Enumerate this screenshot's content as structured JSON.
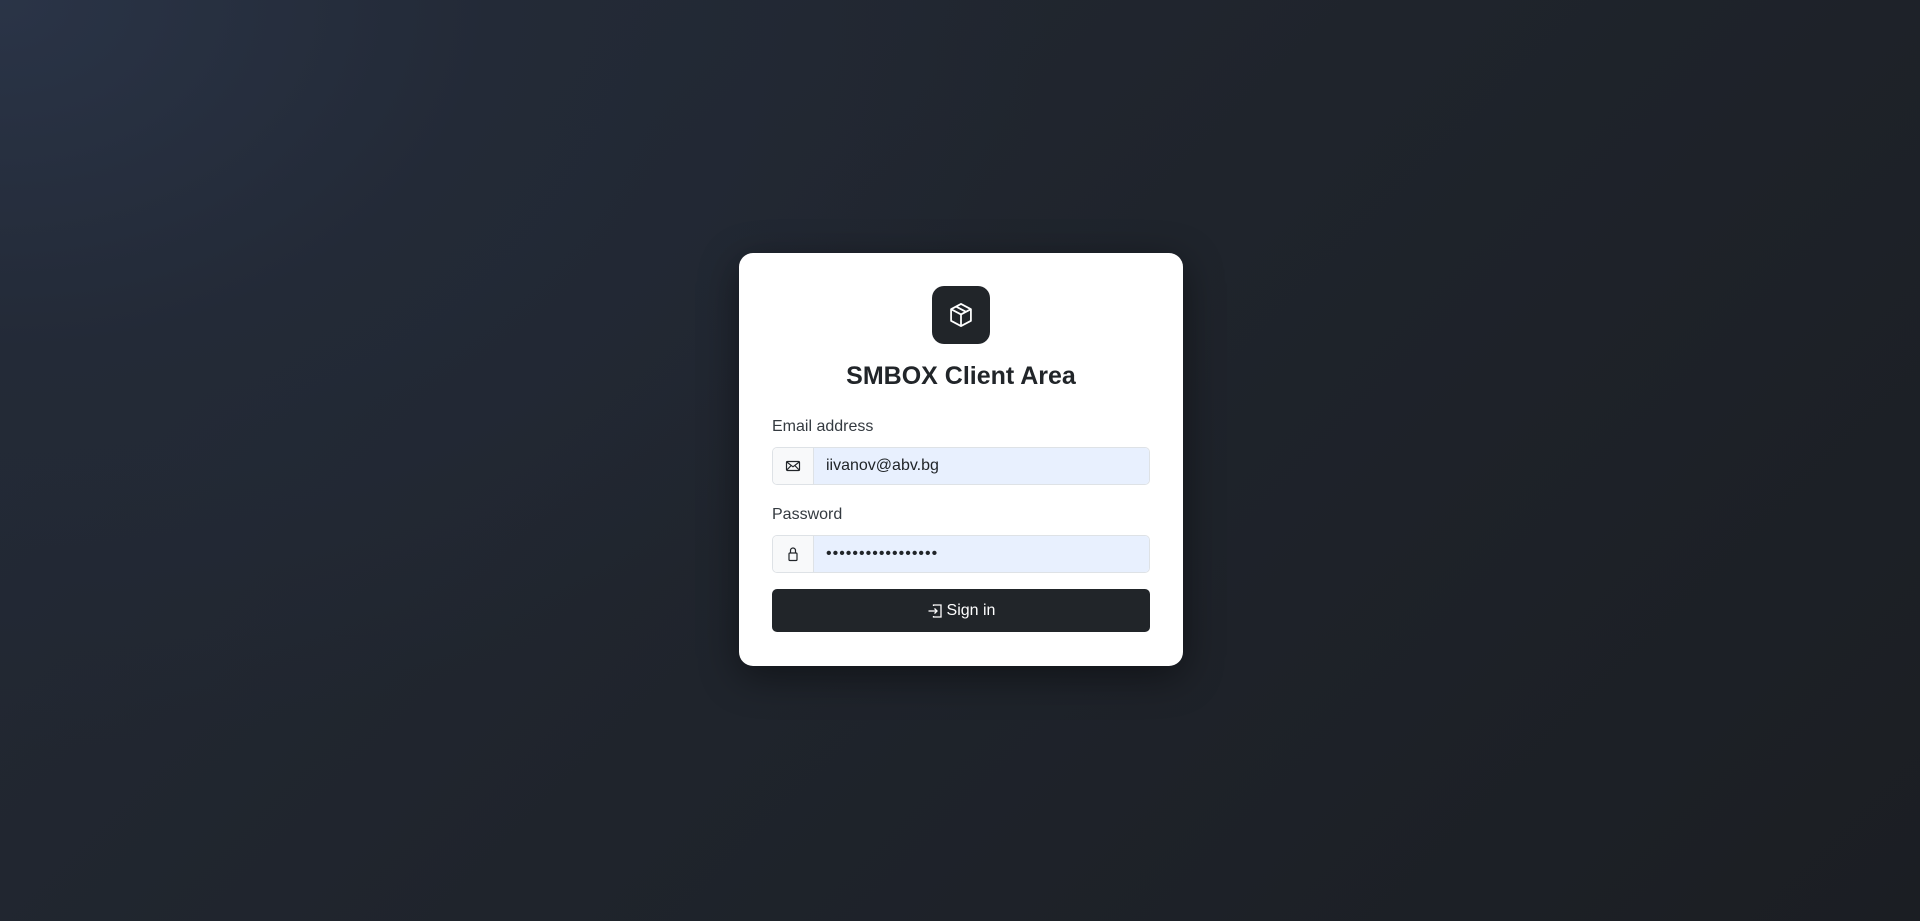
{
  "app": {
    "title": "SMBOX Client Area",
    "logo_icon": "box-icon"
  },
  "form": {
    "email": {
      "label": "Email address",
      "value": "iivanov@abv.bg",
      "icon": "envelope-icon"
    },
    "password": {
      "label": "Password",
      "value": "•••••••••••••••••",
      "icon": "lock-icon"
    },
    "submit": {
      "label": "Sign in",
      "icon": "sign-in-icon"
    }
  },
  "colors": {
    "primary": "#212529",
    "card": "#ffffff",
    "autofill": "#e8f0fe",
    "background": "#1d2127"
  }
}
